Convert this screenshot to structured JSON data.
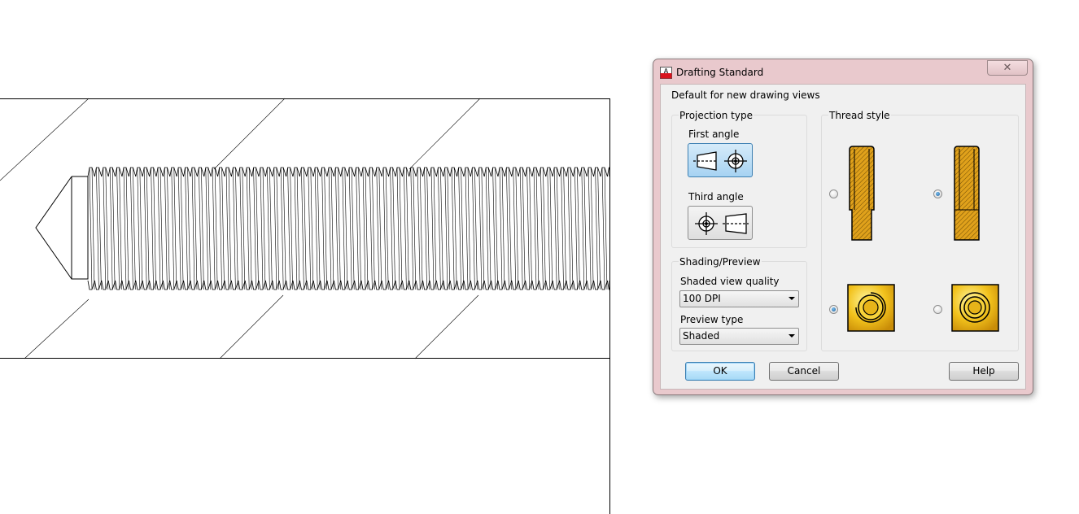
{
  "dialog": {
    "title": "Drafting Standard",
    "close_label": "✕",
    "intro": "Default for new drawing views",
    "projection": {
      "group_label": "Projection type",
      "first_angle_label": "First angle",
      "third_angle_label": "Third angle",
      "selected": "first"
    },
    "thread_style": {
      "group_label": "Thread style",
      "selected_section": "right",
      "selected_end": "left"
    },
    "shading": {
      "group_label": "Shading/Preview",
      "quality_label": "Shaded view quality",
      "quality_value": "100 DPI",
      "preview_label": "Preview type",
      "preview_value": "Shaded"
    },
    "buttons": {
      "ok": "OK",
      "cancel": "Cancel",
      "help": "Help"
    }
  },
  "colors": {
    "dialog_frame": "#e9c9cd",
    "thread_gold": "#e0a11b",
    "selected_button": "#a6d2f2",
    "app_icon_red": "#d8131d"
  }
}
